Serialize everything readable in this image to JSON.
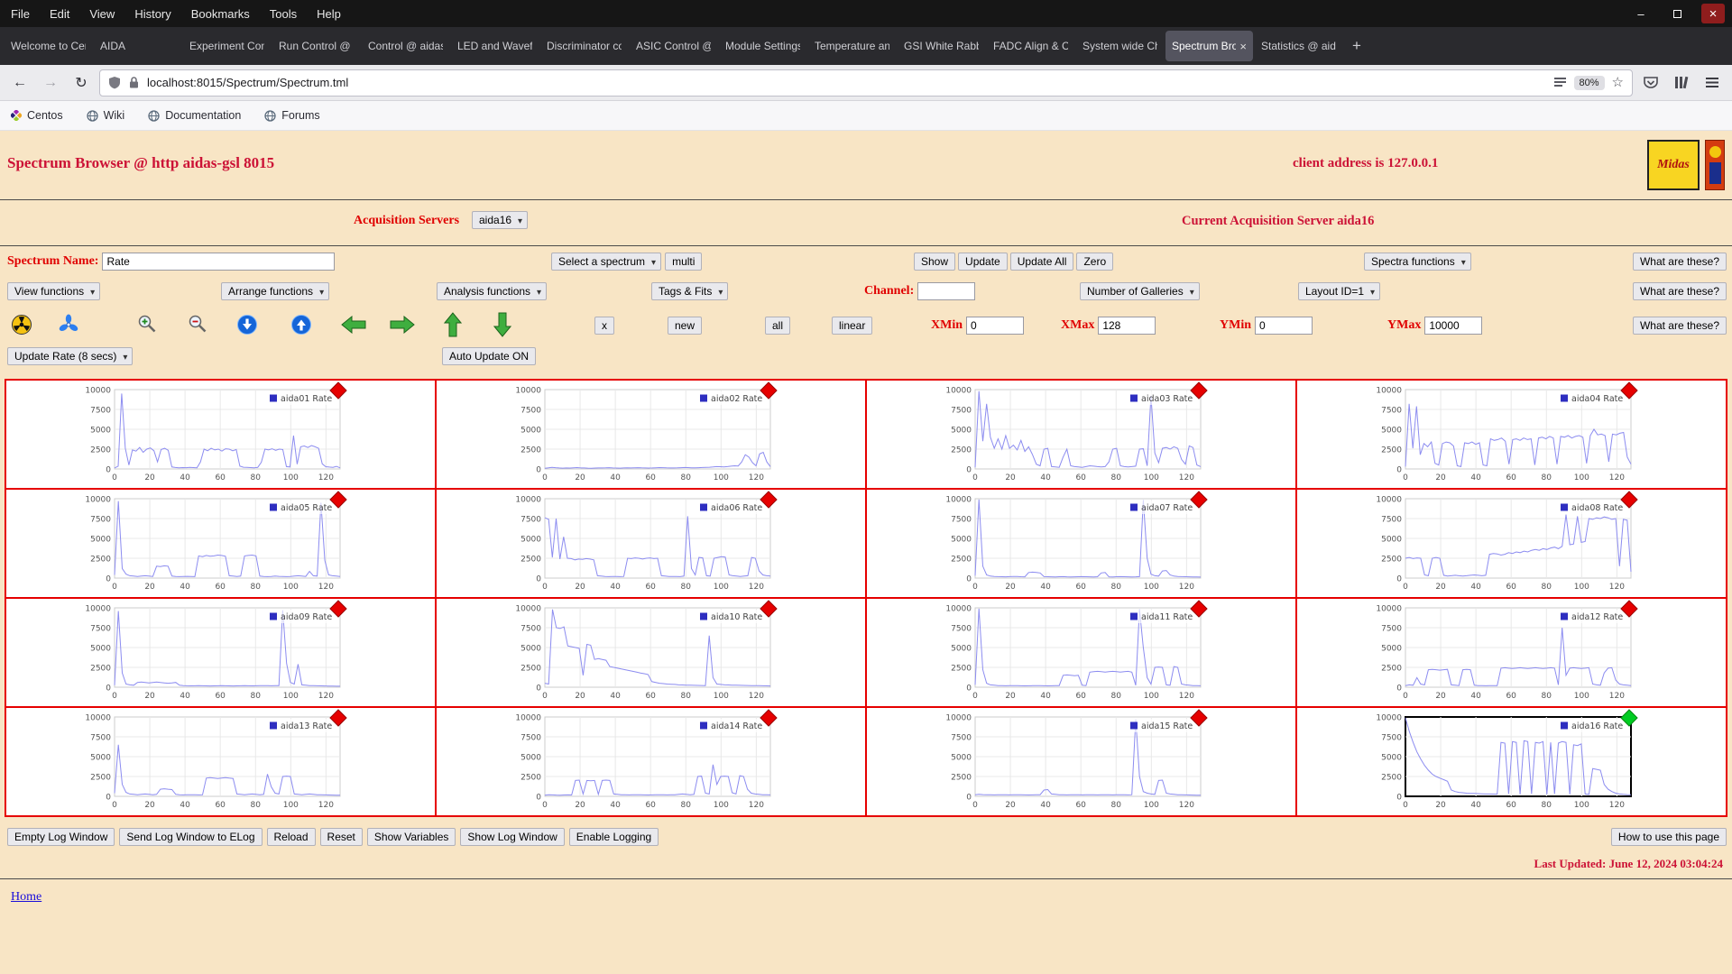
{
  "browser": {
    "menu": [
      "File",
      "Edit",
      "View",
      "History",
      "Bookmarks",
      "Tools",
      "Help"
    ],
    "tabs": [
      {
        "label": "Welcome to Cen"
      },
      {
        "label": "AIDA"
      },
      {
        "label": "Experiment Con"
      },
      {
        "label": "Run Control @ a"
      },
      {
        "label": "Control @ aidas"
      },
      {
        "label": "LED and Wavefo"
      },
      {
        "label": "Discriminator co"
      },
      {
        "label": "ASIC Control @"
      },
      {
        "label": "Module Settings"
      },
      {
        "label": "Temperature an"
      },
      {
        "label": "GSI White Rabb"
      },
      {
        "label": "FADC Align & C"
      },
      {
        "label": "System wide Ch"
      },
      {
        "label": "Spectrum Bro",
        "active": true
      },
      {
        "label": "Statistics @ aid"
      }
    ],
    "url": "localhost:8015/Spectrum/Spectrum.tml",
    "zoom": "80%",
    "bookmarks": [
      {
        "label": "Centos",
        "icon": "centos-icon"
      },
      {
        "label": "Wiki",
        "icon": "globe-icon"
      },
      {
        "label": "Documentation",
        "icon": "globe-icon"
      },
      {
        "label": "Forums",
        "icon": "globe-icon"
      }
    ]
  },
  "page": {
    "title": "Spectrum Browser @ http aidas-gsl 8015",
    "client_address": "client address is 127.0.0.1",
    "logo_text": "Midas",
    "acquisition": {
      "label": "Acquisition Servers",
      "selected": "aida16",
      "current": "Current Acquisition Server aida16"
    },
    "controls": {
      "spectrum_name_label": "Spectrum Name:",
      "spectrum_name_value": "Rate",
      "select_spectrum": "Select a spectrum",
      "multi": "multi",
      "show": "Show",
      "update": "Update",
      "update_all": "Update All",
      "zero": "Zero",
      "spectra_functions": "Spectra functions",
      "what_are_these": "What are these?",
      "view_functions": "View functions",
      "arrange_functions": "Arrange functions",
      "analysis_functions": "Analysis functions",
      "tags_fits": "Tags & Fits",
      "channel_label": "Channel:",
      "channel_value": "",
      "number_of_galleries": "Number of Galleries",
      "layout_id": "Layout ID=1",
      "x_button": "x",
      "new_button": "new",
      "all_button": "all",
      "linear_button": "linear",
      "xmin_label": "XMin",
      "xmin_value": "0",
      "xmax_label": "XMax",
      "xmax_value": "128",
      "ymin_label": "YMin",
      "ymin_value": "0",
      "ymax_label": "YMax",
      "ymax_value": "10000",
      "update_rate": "Update Rate (8 secs)",
      "auto_update": "Auto Update ON"
    },
    "footer": {
      "buttons": [
        "Empty Log Window",
        "Send Log Window to ELog",
        "Reload",
        "Reset",
        "Show Variables",
        "Show Log Window",
        "Enable Logging"
      ],
      "help_button": "How to use this page",
      "last_updated": "Last Updated: June 12, 2024 03:04:24",
      "home": "Home"
    }
  },
  "chart_data": {
    "type": "line",
    "x_ticks": [
      0,
      20,
      40,
      60,
      80,
      100,
      120
    ],
    "y_ticks": [
      0,
      2500,
      5000,
      7500,
      10000
    ],
    "xlim": [
      0,
      128
    ],
    "ylim": [
      0,
      10000
    ],
    "series_color": "#8c8cf0",
    "legend_square_color": "#2e2ec0",
    "marker_red": "#e60000",
    "marker_green": "#00cc22",
    "galleries": [
      {
        "name": "aida01 Rate",
        "values": [
          120,
          350,
          9500,
          2600,
          500,
          2400,
          2250,
          2700,
          2100,
          2500,
          2650,
          2300,
          900,
          2450,
          2600,
          2350,
          250,
          180,
          150,
          170,
          160,
          190,
          170,
          150,
          880,
          2500,
          2300,
          2600,
          2400,
          2500,
          2250,
          2550,
          2500,
          2300,
          2450,
          350,
          220,
          190,
          170,
          150,
          190,
          850,
          2500,
          2400,
          2550,
          2350,
          2500,
          2450,
          300,
          250,
          4200,
          600,
          2800,
          2900,
          2700,
          2950,
          2800,
          2600,
          650,
          280,
          240,
          200,
          330,
          140
        ]
      },
      {
        "name": "aida02 Rate",
        "values": [
          90,
          140,
          200,
          160,
          120,
          100,
          130,
          110,
          150,
          170,
          130,
          120,
          100,
          90,
          110,
          130,
          120,
          140,
          160,
          130,
          110,
          100,
          120,
          140,
          130,
          150,
          160,
          140,
          120,
          110,
          130,
          150,
          170,
          160,
          140,
          130,
          120,
          140,
          160,
          180,
          170,
          150,
          140,
          160,
          180,
          200,
          220,
          250,
          300,
          280,
          260,
          300,
          350,
          400,
          380,
          900,
          1800,
          1500,
          800,
          400,
          1900,
          2100,
          900,
          300
        ]
      },
      {
        "name": "aida03 Rate",
        "values": [
          200,
          9800,
          3500,
          8200,
          4000,
          2600,
          3800,
          2500,
          4200,
          2600,
          3000,
          2400,
          3600,
          2200,
          2800,
          1800,
          600,
          400,
          2500,
          2600,
          300,
          250,
          200,
          1500,
          2500,
          400,
          300,
          250,
          200,
          300,
          400,
          350,
          300,
          250,
          300,
          900,
          2500,
          2600,
          400,
          300,
          250,
          300,
          350,
          2500,
          2550,
          400,
          9200,
          2000,
          800,
          2600,
          2700,
          2500,
          2800,
          2600,
          1200,
          600,
          2900,
          2700,
          500,
          300
        ]
      },
      {
        "name": "aida04 Rate",
        "values": [
          300,
          8200,
          2600,
          7900,
          1800,
          3200,
          2800,
          3400,
          700,
          500,
          3200,
          3400,
          3300,
          2900,
          400,
          300,
          3300,
          3200,
          3400,
          3100,
          3300,
          500,
          400,
          3800,
          3600,
          3700,
          3900,
          3500,
          600,
          3700,
          3800,
          3600,
          3900,
          3700,
          3800,
          500,
          3900,
          4000,
          3800,
          4100,
          3900,
          600,
          4100,
          4000,
          4200,
          3900,
          4100,
          4200,
          4000,
          700,
          4200,
          5000,
          4300,
          4400,
          4200,
          900,
          4400,
          4300,
          4500,
          4600,
          1500,
          600
        ]
      },
      {
        "name": "aida05 Rate",
        "values": [
          400,
          9700,
          1200,
          500,
          300,
          250,
          200,
          250,
          300,
          250,
          200,
          1500,
          1450,
          1550,
          1500,
          250,
          200,
          180,
          200,
          220,
          200,
          180,
          2800,
          2700,
          2850,
          2750,
          2800,
          2900,
          2850,
          2750,
          300,
          250,
          200,
          250,
          2800,
          2850,
          2900,
          2800,
          250,
          200,
          180,
          200,
          250,
          220,
          200,
          180,
          200,
          250,
          300,
          250,
          200,
          850,
          300,
          250,
          9500,
          2200,
          400,
          300,
          250,
          200
        ]
      },
      {
        "name": "aida06 Rate",
        "values": [
          7600,
          7400,
          2600,
          7500,
          2400,
          5200,
          2500,
          2450,
          2300,
          2400,
          2350,
          2450,
          2400,
          2300,
          300,
          250,
          200,
          180,
          200,
          190,
          180,
          200,
          2500,
          2450,
          2550,
          2500,
          2400,
          2500,
          2550,
          2450,
          2500,
          300,
          250,
          200,
          190,
          200,
          180,
          250,
          7800,
          1200,
          400,
          2600,
          2550,
          300,
          250,
          2500,
          2600,
          2700,
          2650,
          400,
          300,
          250,
          200,
          250,
          300,
          2600,
          2500,
          900,
          400,
          300,
          250
        ]
      },
      {
        "name": "aida07 Rate",
        "values": [
          300,
          9900,
          1500,
          400,
          250,
          200,
          180,
          170,
          160,
          180,
          200,
          190,
          170,
          160,
          700,
          750,
          700,
          650,
          180,
          170,
          160,
          150,
          170,
          180,
          160,
          150,
          160,
          170,
          180,
          170,
          160,
          150,
          170,
          650,
          700,
          160,
          150,
          170,
          180,
          170,
          160,
          150,
          160,
          180,
          9800,
          2500,
          500,
          300,
          250,
          900,
          950,
          400,
          250,
          200,
          180,
          170,
          160,
          150,
          140,
          130
        ]
      },
      {
        "name": "aida08 Rate",
        "values": [
          2500,
          2600,
          2450,
          2550,
          2500,
          400,
          300,
          2500,
          2600,
          2500,
          350,
          250,
          300,
          350,
          300,
          250,
          300,
          350,
          400,
          350,
          300,
          350,
          3000,
          3100,
          3050,
          2900,
          3000,
          3200,
          3100,
          3300,
          3200,
          3400,
          3300,
          3500,
          3600,
          3500,
          3700,
          3600,
          3800,
          3900,
          3700,
          4000,
          8000,
          4200,
          4300,
          7800,
          4500,
          4600,
          7500,
          7400,
          7600,
          7500,
          7700,
          7600,
          7400,
          7500,
          1500,
          7400,
          7300,
          800
        ]
      },
      {
        "name": "aida09 Rate",
        "values": [
          250,
          9600,
          1800,
          400,
          300,
          250,
          600,
          650,
          600,
          550,
          600,
          650,
          600,
          550,
          500,
          550,
          600,
          250,
          200,
          180,
          170,
          180,
          190,
          180,
          170,
          160,
          170,
          180,
          190,
          180,
          170,
          160,
          170,
          180,
          190,
          180,
          170,
          180,
          190,
          200,
          190,
          180,
          190,
          200,
          9700,
          3000,
          600,
          400,
          2900,
          300,
          250,
          200,
          190,
          180,
          170,
          160,
          150,
          140,
          130,
          120
        ]
      },
      {
        "name": "aida10 Rate",
        "values": [
          500,
          400,
          9800,
          7500,
          7400,
          7600,
          5200,
          5100,
          5000,
          4900,
          1500,
          5400,
          5300,
          3500,
          3600,
          3500,
          3400,
          2600,
          2500,
          2400,
          2300,
          2200,
          2100,
          2000,
          1900,
          1800,
          1700,
          1600,
          700,
          600,
          500,
          450,
          400,
          380,
          350,
          300,
          280,
          260,
          250,
          240,
          230,
          220,
          210,
          6500,
          1200,
          400,
          350,
          300,
          280,
          260,
          250,
          240,
          230,
          220,
          210,
          200,
          190,
          180,
          170,
          160
        ]
      },
      {
        "name": "aida11 Rate",
        "values": [
          300,
          9900,
          2200,
          500,
          300,
          250,
          200,
          190,
          180,
          190,
          200,
          190,
          180,
          170,
          180,
          190,
          200,
          190,
          180,
          170,
          180,
          190,
          200,
          1500,
          1550,
          1500,
          1450,
          1500,
          250,
          200,
          1900,
          1950,
          2000,
          1950,
          1900,
          1950,
          2000,
          1950,
          1900,
          1950,
          2000,
          1900,
          250,
          9800,
          5000,
          1200,
          400,
          2500,
          2550,
          2500,
          300,
          250,
          2600,
          2500,
          400,
          300,
          250,
          200,
          190,
          180
        ]
      },
      {
        "name": "aida12 Rate",
        "values": [
          200,
          300,
          250,
          1200,
          400,
          300,
          2200,
          2250,
          2200,
          2150,
          2200,
          2250,
          300,
          250,
          200,
          2200,
          2250,
          2200,
          250,
          200,
          190,
          180,
          190,
          200,
          190,
          2400,
          2450,
          2400,
          2350,
          2400,
          2450,
          2400,
          2350,
          2400,
          2450,
          2400,
          2350,
          2400,
          2450,
          2400,
          300,
          7500,
          1500,
          2400,
          2450,
          2400,
          2350,
          2400,
          2450,
          400,
          300,
          250,
          1800,
          2400,
          2450,
          900,
          400,
          300,
          250,
          200
        ]
      },
      {
        "name": "aida13 Rate",
        "values": [
          400,
          6500,
          1500,
          500,
          300,
          250,
          200,
          250,
          300,
          250,
          200,
          250,
          900,
          950,
          900,
          850,
          250,
          200,
          180,
          190,
          200,
          190,
          180,
          190,
          2300,
          2350,
          2300,
          2250,
          2300,
          2350,
          2300,
          2250,
          300,
          250,
          200,
          250,
          300,
          250,
          200,
          250,
          2800,
          1200,
          400,
          300,
          2500,
          2550,
          2500,
          300,
          250,
          200,
          250,
          300,
          250,
          200,
          190,
          180,
          170,
          160,
          150,
          140
        ]
      },
      {
        "name": "aida14 Rate",
        "values": [
          150,
          200,
          180,
          160,
          150,
          170,
          180,
          170,
          2000,
          2050,
          300,
          2000,
          1950,
          2000,
          250,
          2000,
          2050,
          2000,
          300,
          250,
          200,
          190,
          180,
          190,
          200,
          190,
          180,
          170,
          180,
          190,
          200,
          190,
          180,
          190,
          200,
          250,
          300,
          250,
          200,
          250,
          2500,
          2550,
          400,
          300,
          4000,
          1500,
          2500,
          2550,
          2500,
          450,
          300,
          2600,
          2500,
          900,
          400,
          300,
          250,
          200,
          190,
          180
        ]
      },
      {
        "name": "aida15 Rate",
        "values": [
          200,
          250,
          220,
          200,
          190,
          180,
          190,
          200,
          190,
          180,
          190,
          200,
          190,
          180,
          170,
          180,
          190,
          200,
          800,
          850,
          300,
          250,
          200,
          190,
          180,
          190,
          200,
          190,
          180,
          190,
          200,
          190,
          180,
          190,
          200,
          190,
          180,
          190,
          200,
          190,
          180,
          200,
          9700,
          2500,
          600,
          400,
          300,
          250,
          2000,
          2050,
          400,
          300,
          250,
          200,
          190,
          180,
          170,
          160,
          150,
          140
        ]
      },
      {
        "name": "aida16 Rate",
        "selected": true,
        "values": [
          9900,
          8200,
          6800,
          5600,
          4700,
          3900,
          3300,
          2800,
          2500,
          2300,
          2100,
          1900,
          800,
          600,
          500,
          450,
          400,
          380,
          360,
          340,
          320,
          300,
          290,
          280,
          270,
          6800,
          6700,
          300,
          6900,
          6800,
          250,
          7000,
          6900,
          300,
          6800,
          6700,
          6900,
          250,
          6800,
          300,
          6700,
          6900,
          6800,
          250,
          6500,
          6400,
          6600,
          300,
          250,
          3500,
          3400,
          3300,
          1500,
          900,
          600,
          400,
          300,
          250,
          220,
          200
        ]
      }
    ]
  }
}
